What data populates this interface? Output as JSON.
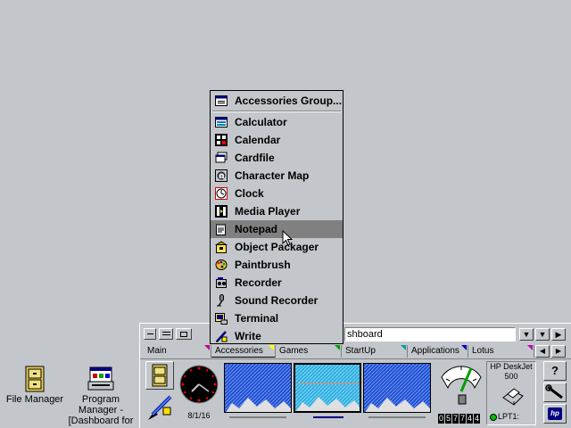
{
  "desktop": {
    "icons": [
      {
        "label": "File Manager"
      },
      {
        "label_lines": [
          "Program",
          "Manager -",
          "[Dashboard for"
        ]
      }
    ]
  },
  "menu": {
    "items": [
      {
        "label": "Accessories Group...",
        "icon": "group-window-icon"
      },
      {
        "label": "Calculator",
        "icon": "calculator-icon"
      },
      {
        "label": "Calendar",
        "icon": "calendar-icon"
      },
      {
        "label": "Cardfile",
        "icon": "cardfile-icon"
      },
      {
        "label": "Character Map",
        "icon": "character-map-icon"
      },
      {
        "label": "Clock",
        "icon": "clock-icon"
      },
      {
        "label": "Media Player",
        "icon": "media-player-icon"
      },
      {
        "label": "Notepad",
        "icon": "notepad-icon",
        "selected": true
      },
      {
        "label": "Object Packager",
        "icon": "object-packager-icon"
      },
      {
        "label": "Paintbrush",
        "icon": "paintbrush-icon"
      },
      {
        "label": "Recorder",
        "icon": "recorder-icon"
      },
      {
        "label": "Sound Recorder",
        "icon": "sound-recorder-icon"
      },
      {
        "label": "Terminal",
        "icon": "terminal-icon"
      },
      {
        "label": "Write",
        "icon": "write-icon"
      }
    ]
  },
  "dashboard": {
    "title_field": "shboard",
    "tabs": [
      {
        "label": "Main",
        "color": "#c00080"
      },
      {
        "label": "Accessories",
        "color": "#ffff00"
      },
      {
        "label": "Games",
        "color": "#00a000"
      },
      {
        "label": "StartUp",
        "color": "#00a0a0"
      },
      {
        "label": "Applications",
        "color": "#0000c0"
      },
      {
        "label": "Lotus",
        "color": "#c000c0"
      }
    ],
    "date": "8/1/16",
    "counter": [
      "0",
      "5",
      "7",
      "7",
      "4",
      "4"
    ],
    "printer": {
      "name": "HP DeskJet",
      "model": "500",
      "port": "LPT1:"
    },
    "help_label": "?"
  },
  "colors": {
    "desktop": "#c3c7cb",
    "selection": "#808080",
    "screen_blue": "#2050d0",
    "screen_cyan": "#30b0e0"
  }
}
